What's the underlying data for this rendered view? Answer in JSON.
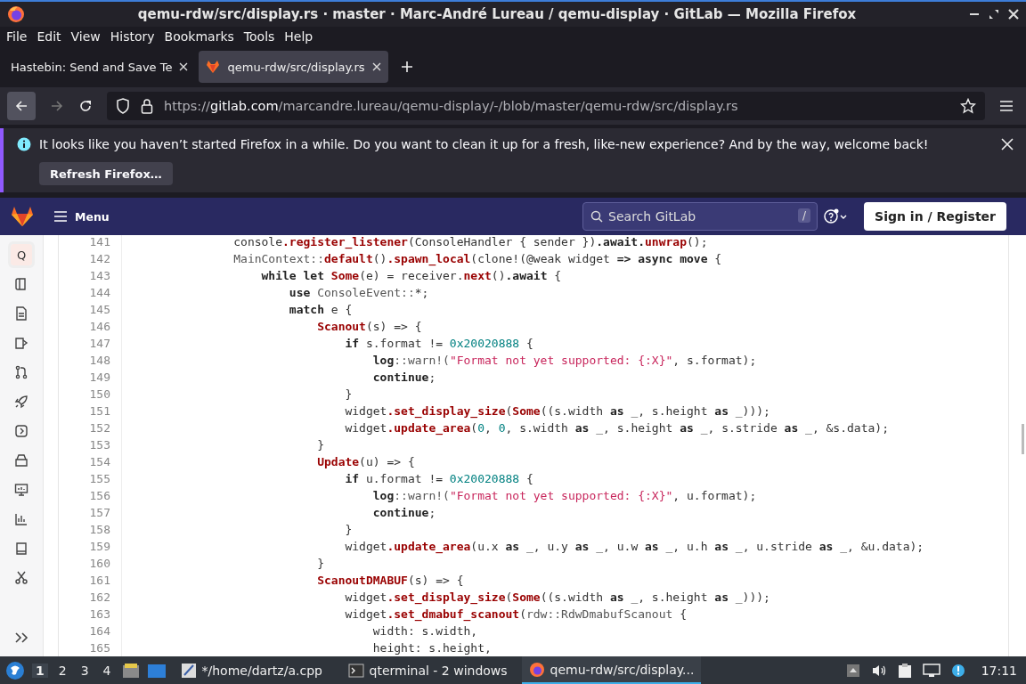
{
  "window": {
    "title": "qemu-rdw/src/display.rs · master · Marc-André Lureau / qemu-display · GitLab — Mozilla Firefox"
  },
  "menu": [
    "File",
    "Edit",
    "View",
    "History",
    "Bookmarks",
    "Tools",
    "Help"
  ],
  "tabs": [
    {
      "title": "Hastebin: Send and Save Te",
      "selected": false
    },
    {
      "title": "qemu-rdw/src/display.rs",
      "selected": true
    }
  ],
  "url": {
    "scheme": "https://",
    "host": "gitlab.com",
    "path": "/marcandre.lureau/qemu-display/-/blob/master/qemu-rdw/src/display.rs"
  },
  "notification": {
    "message": "It looks like you haven’t started Firefox in a while. Do you want to clean it up for a fresh, like-new experience? And by the way, welcome back!",
    "button": "Refresh Firefox…"
  },
  "gitlab": {
    "menu": "Menu",
    "search_placeholder": "Search GitLab",
    "search_shortcut": "/",
    "sign_in": "Sign in / Register"
  },
  "sidebar": [
    {
      "kind": "avatar",
      "label": "Q",
      "selected": true
    },
    {
      "kind": "repository",
      "selected": false
    },
    {
      "kind": "issues",
      "selected": false
    },
    {
      "kind": "tag",
      "selected": false
    },
    {
      "kind": "merge",
      "selected": false
    },
    {
      "kind": "rocket",
      "selected": false
    },
    {
      "kind": "play",
      "selected": false
    },
    {
      "kind": "package",
      "selected": false
    },
    {
      "kind": "monitor",
      "selected": false
    },
    {
      "kind": "chart",
      "selected": false
    },
    {
      "kind": "book",
      "selected": false
    },
    {
      "kind": "scissors",
      "selected": false
    }
  ],
  "code": [
    {
      "number": "141",
      "segments": [
        {
          "kind": "plain",
          "text": "                console"
        },
        {
          "kind": "fn",
          "text": ".register_listener"
        },
        {
          "kind": "plain",
          "text": "(ConsoleHandler { sender })"
        },
        {
          "kind": "kw",
          "text": ".await."
        },
        {
          "kind": "fn",
          "text": "unwrap"
        },
        {
          "kind": "plain",
          "text": "();"
        }
      ]
    },
    {
      "number": "142",
      "segments": [
        {
          "kind": "path",
          "text": "                MainContext::"
        },
        {
          "kind": "fn",
          "text": "default"
        },
        {
          "kind": "plain",
          "text": "()"
        },
        {
          "kind": "fn",
          "text": ".spawn_local"
        },
        {
          "kind": "plain",
          "text": "(clone!(@weak widget "
        },
        {
          "kind": "kw",
          "text": "=> async move"
        },
        {
          "kind": "plain",
          "text": " {"
        }
      ]
    },
    {
      "number": "143",
      "segments": [
        {
          "kind": "kw",
          "text": "                    while let "
        },
        {
          "kind": "fn",
          "text": "Some"
        },
        {
          "kind": "plain",
          "text": "(e) = receiver."
        },
        {
          "kind": "fn",
          "text": "next"
        },
        {
          "kind": "plain",
          "text": "()"
        },
        {
          "kind": "kw",
          "text": ".await"
        },
        {
          "kind": "plain",
          "text": " {"
        }
      ]
    },
    {
      "number": "144",
      "segments": [
        {
          "kind": "kw",
          "text": "                        use "
        },
        {
          "kind": "path",
          "text": "ConsoleEvent::"
        },
        {
          "kind": "plain",
          "text": "*;"
        }
      ]
    },
    {
      "number": "145",
      "segments": [
        {
          "kind": "kw",
          "text": "                        match"
        },
        {
          "kind": "plain",
          "text": " e {"
        }
      ]
    },
    {
      "number": "146",
      "segments": [
        {
          "kind": "fn",
          "text": "                            Scanout"
        },
        {
          "kind": "plain",
          "text": "(s) => {"
        }
      ]
    },
    {
      "number": "147",
      "segments": [
        {
          "kind": "kw",
          "text": "                                if"
        },
        {
          "kind": "plain",
          "text": " s.format != "
        },
        {
          "kind": "num",
          "text": "0x20020888"
        },
        {
          "kind": "plain",
          "text": " {"
        }
      ]
    },
    {
      "number": "148",
      "segments": [
        {
          "kind": "kw",
          "text": "                                    log"
        },
        {
          "kind": "path",
          "text": "::warn!("
        },
        {
          "kind": "str",
          "text": "\"Format not yet supported: {:X}\""
        },
        {
          "kind": "plain",
          "text": ", s.format);"
        }
      ]
    },
    {
      "number": "149",
      "segments": [
        {
          "kind": "kw",
          "text": "                                    continue"
        },
        {
          "kind": "plain",
          "text": ";"
        }
      ]
    },
    {
      "number": "150",
      "segments": [
        {
          "kind": "plain",
          "text": "                                }"
        }
      ]
    },
    {
      "number": "151",
      "segments": [
        {
          "kind": "plain",
          "text": "                                widget"
        },
        {
          "kind": "fn",
          "text": ".set_display_size"
        },
        {
          "kind": "plain",
          "text": "("
        },
        {
          "kind": "fn",
          "text": "Some"
        },
        {
          "kind": "plain",
          "text": "((s.width "
        },
        {
          "kind": "kw",
          "text": "as"
        },
        {
          "kind": "plain",
          "text": " _, s.height "
        },
        {
          "kind": "kw",
          "text": "as"
        },
        {
          "kind": "plain",
          "text": " _)));"
        }
      ]
    },
    {
      "number": "152",
      "segments": [
        {
          "kind": "plain",
          "text": "                                widget"
        },
        {
          "kind": "fn",
          "text": ".update_area"
        },
        {
          "kind": "plain",
          "text": "("
        },
        {
          "kind": "num",
          "text": "0"
        },
        {
          "kind": "plain",
          "text": ", "
        },
        {
          "kind": "num",
          "text": "0"
        },
        {
          "kind": "plain",
          "text": ", s.width "
        },
        {
          "kind": "kw",
          "text": "as"
        },
        {
          "kind": "plain",
          "text": " _, s.height "
        },
        {
          "kind": "kw",
          "text": "as"
        },
        {
          "kind": "plain",
          "text": " _, s.stride "
        },
        {
          "kind": "kw",
          "text": "as"
        },
        {
          "kind": "plain",
          "text": " _, &s.data);"
        }
      ]
    },
    {
      "number": "153",
      "segments": [
        {
          "kind": "plain",
          "text": "                            }"
        }
      ]
    },
    {
      "number": "154",
      "segments": [
        {
          "kind": "fn",
          "text": "                            Update"
        },
        {
          "kind": "plain",
          "text": "(u) => {"
        }
      ]
    },
    {
      "number": "155",
      "segments": [
        {
          "kind": "kw",
          "text": "                                if"
        },
        {
          "kind": "plain",
          "text": " u.format != "
        },
        {
          "kind": "num",
          "text": "0x20020888"
        },
        {
          "kind": "plain",
          "text": " {"
        }
      ]
    },
    {
      "number": "156",
      "segments": [
        {
          "kind": "kw",
          "text": "                                    log"
        },
        {
          "kind": "path",
          "text": "::warn!("
        },
        {
          "kind": "str",
          "text": "\"Format not yet supported: {:X}\""
        },
        {
          "kind": "plain",
          "text": ", u.format);"
        }
      ]
    },
    {
      "number": "157",
      "segments": [
        {
          "kind": "kw",
          "text": "                                    continue"
        },
        {
          "kind": "plain",
          "text": ";"
        }
      ]
    },
    {
      "number": "158",
      "segments": [
        {
          "kind": "plain",
          "text": "                                }"
        }
      ]
    },
    {
      "number": "159",
      "segments": [
        {
          "kind": "plain",
          "text": "                                widget"
        },
        {
          "kind": "fn",
          "text": ".update_area"
        },
        {
          "kind": "plain",
          "text": "(u.x "
        },
        {
          "kind": "kw",
          "text": "as"
        },
        {
          "kind": "plain",
          "text": " _, u.y "
        },
        {
          "kind": "kw",
          "text": "as"
        },
        {
          "kind": "plain",
          "text": " _, u.w "
        },
        {
          "kind": "kw",
          "text": "as"
        },
        {
          "kind": "plain",
          "text": " _, u.h "
        },
        {
          "kind": "kw",
          "text": "as"
        },
        {
          "kind": "plain",
          "text": " _, u.stride "
        },
        {
          "kind": "kw",
          "text": "as"
        },
        {
          "kind": "plain",
          "text": " _, &u.data);"
        }
      ]
    },
    {
      "number": "160",
      "segments": [
        {
          "kind": "plain",
          "text": "                            }"
        }
      ]
    },
    {
      "number": "161",
      "segments": [
        {
          "kind": "fn",
          "text": "                            ScanoutDMABUF"
        },
        {
          "kind": "plain",
          "text": "(s) => {"
        }
      ]
    },
    {
      "number": "162",
      "segments": [
        {
          "kind": "plain",
          "text": "                                widget"
        },
        {
          "kind": "fn",
          "text": ".set_display_size"
        },
        {
          "kind": "plain",
          "text": "("
        },
        {
          "kind": "fn",
          "text": "Some"
        },
        {
          "kind": "plain",
          "text": "((s.width "
        },
        {
          "kind": "kw",
          "text": "as"
        },
        {
          "kind": "plain",
          "text": " _, s.height "
        },
        {
          "kind": "kw",
          "text": "as"
        },
        {
          "kind": "plain",
          "text": " _)));"
        }
      ]
    },
    {
      "number": "163",
      "segments": [
        {
          "kind": "plain",
          "text": "                                widget"
        },
        {
          "kind": "fn",
          "text": ".set_dmabuf_scanout"
        },
        {
          "kind": "plain",
          "text": "("
        },
        {
          "kind": "path",
          "text": "rdw::RdwDmabufScanout"
        },
        {
          "kind": "plain",
          "text": " {"
        }
      ]
    },
    {
      "number": "164",
      "segments": [
        {
          "kind": "plain",
          "text": "                                    width: s.width,"
        }
      ]
    },
    {
      "number": "165",
      "segments": [
        {
          "kind": "plain",
          "text": "                                    height: s.height,"
        }
      ]
    }
  ],
  "taskbar": {
    "workspaces": [
      {
        "label": "1",
        "selected": true
      },
      {
        "label": "2",
        "selected": false
      },
      {
        "label": "3",
        "selected": false
      },
      {
        "label": "4",
        "selected": false
      }
    ],
    "tasks": [
      {
        "kind": "editor",
        "title": "*/home/dartz/a.cpp",
        "selected": false
      },
      {
        "kind": "terminal",
        "title": "qterminal - 2 windows",
        "selected": false
      },
      {
        "kind": "browser",
        "title": "qemu-rdw/src/display...",
        "selected": true
      }
    ],
    "clock": "17:11"
  }
}
